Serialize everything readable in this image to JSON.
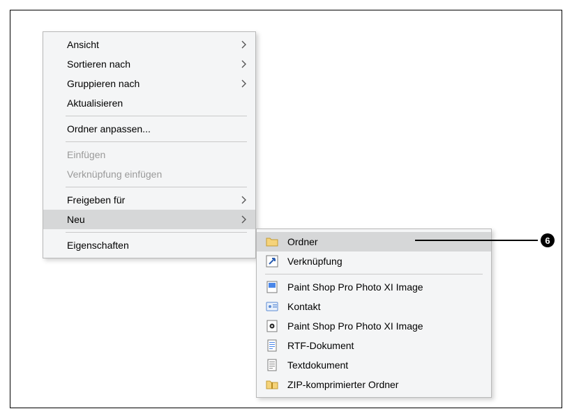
{
  "main_menu": {
    "view": "Ansicht",
    "sort_by": "Sortieren nach",
    "group_by": "Gruppieren nach",
    "refresh": "Aktualisieren",
    "customize_folder": "Ordner anpassen...",
    "paste": "Einfügen",
    "paste_shortcut": "Verknüpfung einfügen",
    "share_with": "Freigeben für",
    "new": "Neu",
    "properties": "Eigenschaften"
  },
  "new_submenu": {
    "folder": "Ordner",
    "shortcut": "Verknüpfung",
    "psp_image_1": "Paint Shop Pro Photo XI Image",
    "contact": "Kontakt",
    "psp_image_2": "Paint Shop Pro Photo XI Image",
    "rtf": "RTF-Dokument",
    "text": "Textdokument",
    "zip": "ZIP-komprimierter Ordner"
  },
  "callout": {
    "number": "6"
  }
}
